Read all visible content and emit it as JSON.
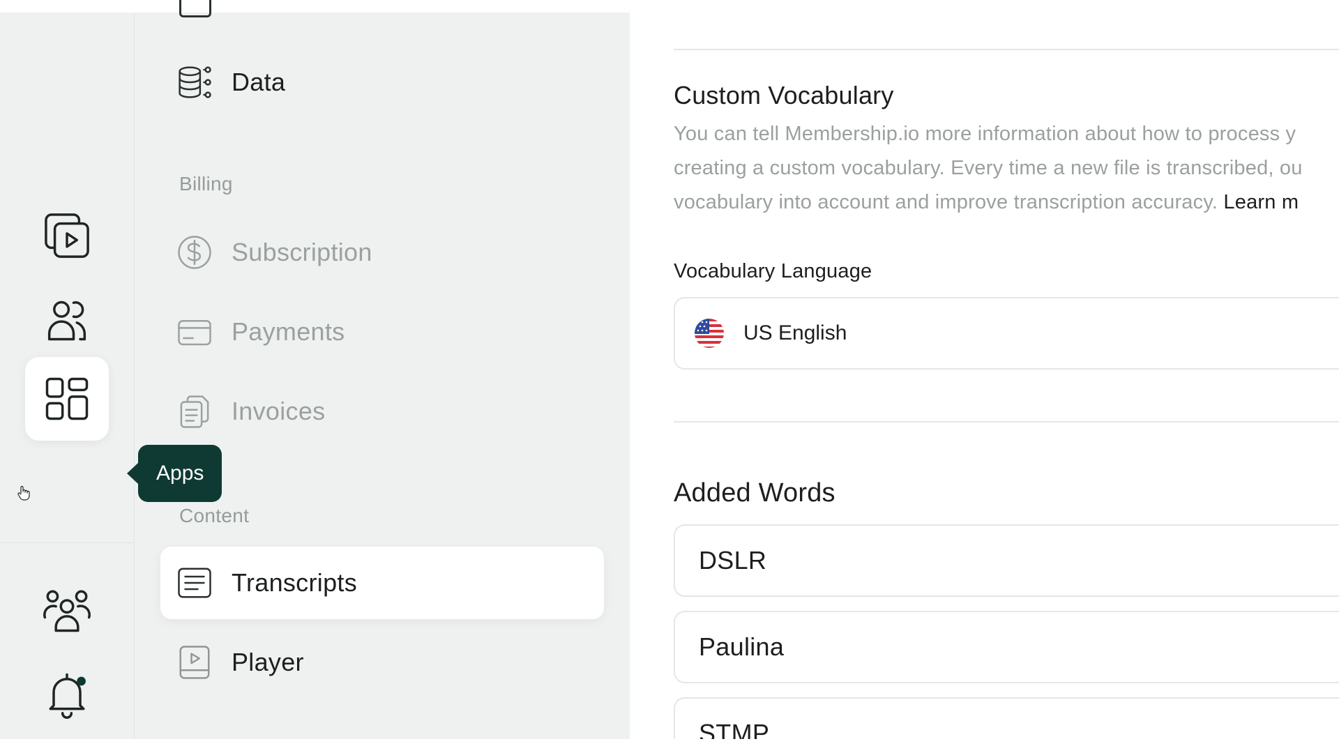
{
  "rail": {
    "items": [
      {
        "name": "videos",
        "icon": "video-library-icon"
      },
      {
        "name": "members",
        "icon": "users-icon"
      },
      {
        "name": "apps",
        "icon": "apps-grid-icon",
        "active": true
      },
      {
        "name": "community",
        "icon": "community-icon"
      },
      {
        "name": "notifications",
        "icon": "bell-icon",
        "has_badge": true
      }
    ],
    "tooltip": "Apps"
  },
  "menu": {
    "data_label": "Data",
    "billing_section": "Billing",
    "subscription_label": "Subscription",
    "payments_label": "Payments",
    "invoices_label": "Invoices",
    "content_section": "Content",
    "transcripts_label": "Transcripts",
    "player_label": "Player",
    "selected": "Transcripts"
  },
  "main": {
    "custom_vocab_title": "Custom Vocabulary",
    "description_lines": [
      "You can tell Membership.io more information about how to process y",
      "creating a custom vocabulary. Every time a new file is transcribed, ou",
      "vocabulary into account and improve transcription accuracy. "
    ],
    "learn_more": "Learn m",
    "language_label": "Vocabulary Language",
    "language_value": "US English",
    "added_words_title": "Added Words",
    "words": [
      "DSLR",
      "Paulina",
      "STMP"
    ]
  },
  "colors": {
    "sidebar_bg": "#eef1f0",
    "tooltip_bg": "#0f3a34",
    "muted_text": "#9aa09d",
    "accent_dot": "#0f3a34"
  }
}
